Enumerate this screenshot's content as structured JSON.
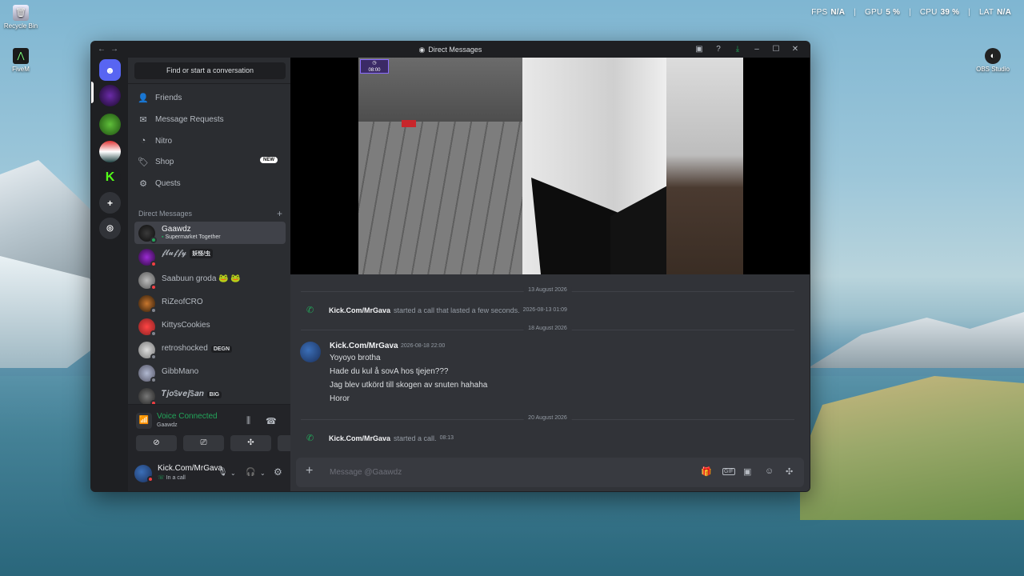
{
  "desktop": {
    "icons": [
      {
        "label": "Recycle Bin",
        "icon": "recycle-bin-icon"
      },
      {
        "label": "FiveM",
        "icon": "fivem-icon"
      },
      {
        "label": "OBS Studio",
        "icon": "obs-icon"
      }
    ],
    "perf": {
      "fps_label": "FPS",
      "fps": "N/A",
      "gpu_label": "GPU",
      "gpu": "5 %",
      "cpu_label": "CPU",
      "cpu": "39 %",
      "lat_label": "LAT",
      "lat": "N/A"
    }
  },
  "window": {
    "title": "Direct Messages"
  },
  "sidebar": {
    "search_placeholder": "Find or start a conversation",
    "nav": [
      {
        "label": "Friends",
        "icon": "friends-icon"
      },
      {
        "label": "Message Requests",
        "icon": "mail-icon"
      },
      {
        "label": "Nitro",
        "icon": "nitro-icon"
      },
      {
        "label": "Shop",
        "icon": "shop-icon",
        "badge": "NEW"
      },
      {
        "label": "Quests",
        "icon": "quests-icon"
      }
    ],
    "dm_header": "Direct Messages",
    "dms": [
      {
        "name": "Gaawdz",
        "status": "Supermarket Together",
        "status_color": "#23a55a"
      },
      {
        "name": "𝓯𝓵𝓾𝓯𝓯𝔂",
        "tag": "妖怪/虫",
        "status_color": "#f23f43"
      },
      {
        "name": "Saabuun groda 🐸 🐸",
        "status_color": "#f23f43"
      },
      {
        "name": "RiZeofCRO",
        "status_color": "#80848e"
      },
      {
        "name": "KittysCookies",
        "status_color": "#80848e"
      },
      {
        "name": "retroshocked",
        "tag": "DEGN",
        "status_color": "#80848e"
      },
      {
        "name": "GibbMano",
        "status_color": "#80848e"
      },
      {
        "name": "𝑻𝒋𝒐$𝒗𝒆𝒋$𝒂𝒏",
        "tag": "BIG",
        "status_color": "#f23f43"
      }
    ]
  },
  "voice": {
    "title": "Voice Connected",
    "channel": "Gaawdz"
  },
  "user": {
    "name": "Kick.Com/MrGava",
    "status": "In a call"
  },
  "stream": {
    "hud_time": "08:00"
  },
  "messages": {
    "dividers": [
      "13 August 2026",
      "18 August 2026",
      "20 August 2026"
    ],
    "call1": {
      "who": "Kick.Com/MrGava",
      "text": "started a call that lasted a few seconds.",
      "ts": "2026-08-13 01:09"
    },
    "msg": {
      "author": "Kick.Com/MrGava",
      "ts": "2026-08-18 22:00",
      "lines": [
        "Yoyoyo brotha",
        "Hade du kul å sovA hos tjejen???",
        "Jag blev utkörd till skogen av snuten hahaha",
        "Horor"
      ]
    },
    "call2": {
      "who": "Kick.Com/MrGava",
      "text": "started a call.",
      "ts": "08:13"
    }
  },
  "composer": {
    "placeholder": "Message @Gaawdz"
  },
  "colors": {
    "accent": "#5865f2",
    "online": "#23a55a",
    "dnd": "#f23f43",
    "offline": "#80848e"
  }
}
